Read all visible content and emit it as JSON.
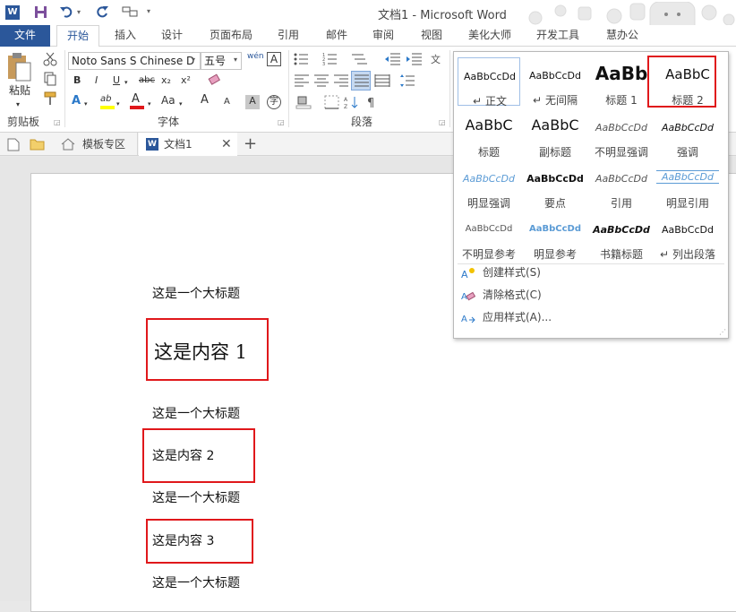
{
  "titlebar": {
    "title": "文档1 - Microsoft Word"
  },
  "ribbon_tabs": [
    "文件",
    "开始",
    "插入",
    "设计",
    "页面布局",
    "引用",
    "邮件",
    "审阅",
    "视图",
    "美化大师",
    "开发工具",
    "慧办公"
  ],
  "clipboard": {
    "paste_label": "粘贴",
    "group_label": "剪贴板"
  },
  "font": {
    "family": "Noto Sans S Chinese D",
    "size": "五号",
    "group_label": "字体",
    "wen": "wén",
    "A": "A",
    "bold": "B",
    "italic": "I",
    "underline": "U",
    "strike": "abc",
    "sub": "x₂",
    "sup": "x²",
    "grow": "A",
    "shrink": "A",
    "aa": "Aa",
    "effects": "A",
    "highlight": "ab",
    "color": "A",
    "charshade": "A",
    "enclose": "字"
  },
  "paragraph": {
    "group_label": "段落"
  },
  "doc_tabs": {
    "template": "模板专区",
    "doc": "文档1"
  },
  "document": {
    "lines": [
      "这是一个大标题",
      "这是内容 1",
      "这是一个大标题",
      "这是内容 2",
      "这是一个大标题",
      "这是内容 3",
      "这是一个大标题"
    ]
  },
  "styles": [
    {
      "sample": "AaBbCcDd",
      "name": "正文",
      "marker": "↵"
    },
    {
      "sample": "AaBbCcDd",
      "name": "无间隔",
      "marker": "↵"
    },
    {
      "sample": "AaBb",
      "name": "标题 1"
    },
    {
      "sample": "AaBbC",
      "name": "标题 2"
    },
    {
      "sample": "AaBbC",
      "name": "标题"
    },
    {
      "sample": "AaBbC",
      "name": "副标题"
    },
    {
      "sample": "AaBbCcDd",
      "name": "不明显强调"
    },
    {
      "sample": "AaBbCcDd",
      "name": "强调"
    },
    {
      "sample": "AaBbCcDd",
      "name": "明显强调"
    },
    {
      "sample": "AaBbCcDd",
      "name": "要点"
    },
    {
      "sample": "AaBbCcDd",
      "name": "引用"
    },
    {
      "sample": "AaBbCcDd",
      "name": "明显引用"
    },
    {
      "sample": "AaBbCcDd",
      "name": "不明显参考"
    },
    {
      "sample": "AaBbCcDd",
      "name": "明显参考"
    },
    {
      "sample": "AaBbCcDd",
      "name": "书籍标题"
    },
    {
      "sample": "AaBbCcDd",
      "name": "列出段落",
      "marker": "↵"
    }
  ],
  "styles_menu": {
    "create": "创建样式(S)",
    "clear": "清除格式(C)",
    "apply": "应用样式(A)..."
  },
  "colors": {
    "accent": "#2b579a",
    "highlight_box": "#e0181b",
    "font_red": "#e0181b",
    "highlight_yellow": "#ffff00"
  }
}
